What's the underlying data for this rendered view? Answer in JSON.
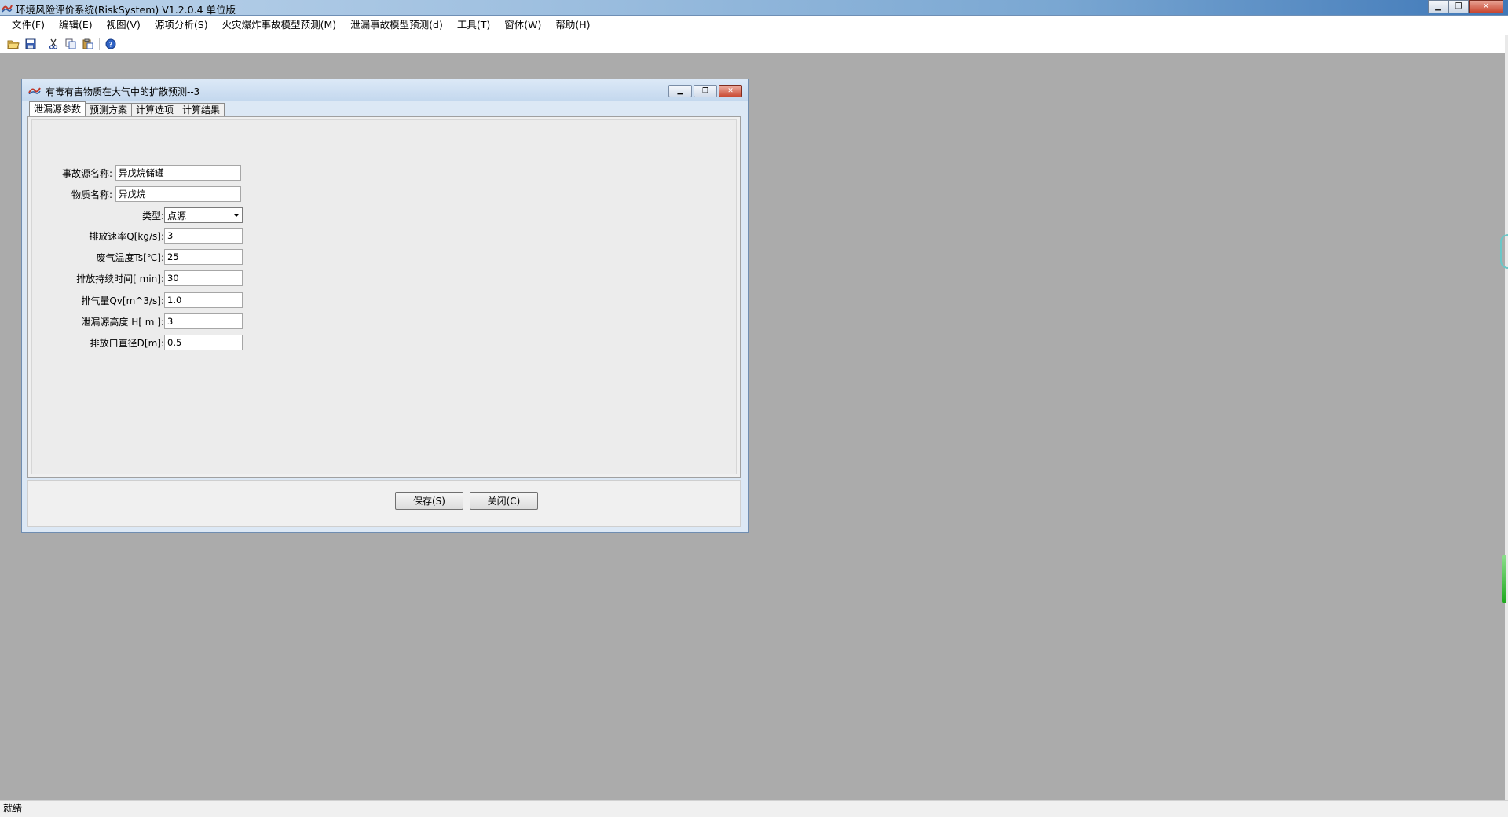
{
  "app": {
    "title": "环境风险评价系统(RiskSystem) V1.2.0.4 单位版",
    "icon": "app-logo-icon"
  },
  "menu": [
    "文件(F)",
    "编辑(E)",
    "视图(V)",
    "源项分析(S)",
    "火灾爆炸事故模型预测(M)",
    "泄漏事故模型预测(d)",
    "工具(T)",
    "窗体(W)",
    "帮助(H)"
  ],
  "toolbar": {
    "icons": [
      "open-folder-icon",
      "save-icon",
      "cut-icon",
      "copy-icon",
      "paste-icon",
      "help-icon"
    ]
  },
  "window": {
    "title": "有毒有害物质在大气中的扩散预测--3",
    "tabs": [
      "泄漏源参数",
      "预测方案",
      "计算选项",
      "计算结果"
    ],
    "active_tab": 0,
    "form": {
      "accident_source_label": "事故源名称:",
      "accident_source_value": "异戊烷储罐",
      "substance_label": "物质名称:",
      "substance_value": "异戊烷",
      "type_label": "类型:",
      "type_value": "点源",
      "emission_rate_label": "排放速率Q[kg/s]:",
      "emission_rate_value": "3",
      "gas_temp_label": "废气温度Ts[℃]:",
      "gas_temp_value": "25",
      "duration_label": "排放持续时间[ min]:",
      "duration_value": "30",
      "exhaust_volume_label": "排气量Qv[m^3/s]:",
      "exhaust_volume_value": "1.0",
      "source_height_label": "泄漏源高度 H[  m ]:",
      "source_height_value": "3",
      "outlet_diameter_label": "排放口直径D[m]:",
      "outlet_diameter_value": "0.5"
    },
    "buttons": {
      "save": "保存(S)",
      "close": "关闭(C)"
    }
  },
  "status": "就绪"
}
